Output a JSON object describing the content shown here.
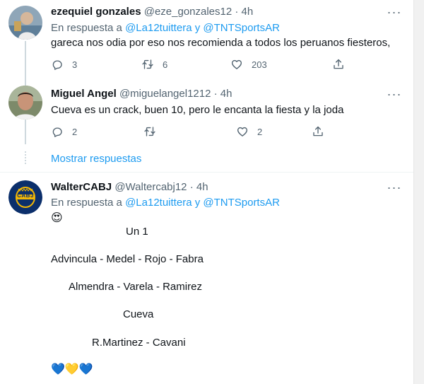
{
  "tweets": [
    {
      "name": "ezequiel gonzales",
      "handle": "@eze_gonzales12",
      "time": "4h",
      "reply_prefix": "En respuesta a",
      "reply_targets": "@La12tuittera y @TNTSportsAR",
      "text": "gareca nos odia por eso nos recomienda a todos los peruanos fiesteros,",
      "counts": {
        "reply": "3",
        "retweet": "6",
        "like": "203"
      }
    },
    {
      "name": "Miguel Angel",
      "handle": "@miguelangel1212",
      "time": "4h",
      "text": "Cueva es un crack, buen 10, pero le encanta la fiesta y la joda",
      "counts": {
        "reply": "2",
        "retweet": "",
        "like": "2"
      }
    },
    {
      "name": "WalterCABJ",
      "handle": "@Waltercabj12",
      "time": "4h",
      "reply_prefix": "En respuesta a",
      "reply_targets": "@La12tuittera y @TNTSportsAR",
      "emoji": "😍",
      "lines": [
        "Un 1",
        "Advincula - Medel - Rojo - Fabra",
        "Almendra - Varela - Ramirez",
        "Cueva",
        "R.Martinez - Cavani"
      ],
      "hearts": "💙💛💙",
      "avatar_text": "CABJ"
    }
  ],
  "separator": "·",
  "show_replies": "Mostrar respuestas",
  "icons": [
    "reply-icon",
    "retweet-icon",
    "like-icon",
    "share-icon",
    "more-icon"
  ],
  "colors": {
    "link": "#1d9bf0",
    "muted": "#536471",
    "text": "#0f1419",
    "boca_blue": "#0b2f6b",
    "boca_gold": "#f2b705"
  }
}
